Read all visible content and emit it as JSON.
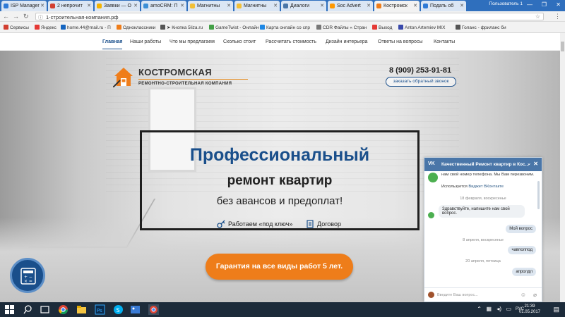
{
  "browser": {
    "tabs": [
      {
        "label": "ISP Manager",
        "color": "#2f7ad6"
      },
      {
        "label": "2 непрочит",
        "color": "#d23f31"
      },
      {
        "label": "Заявки — О",
        "color": "#f4b400"
      },
      {
        "label": "amoCRM: П",
        "color": "#3d8fd6"
      },
      {
        "label": "Магнитны",
        "color": "#f2c037"
      },
      {
        "label": "Магнитны",
        "color": "#f2c037"
      },
      {
        "label": "Диалоги",
        "color": "#4a76a8"
      },
      {
        "label": "Soc Advert",
        "color": "#ff9800"
      },
      {
        "label": "Костромск",
        "color": "#ef7d1a"
      },
      {
        "label": "Подать об",
        "color": "#2f7ad6"
      }
    ],
    "profile": "Пользователь 1",
    "url": "1-строительная-компания.рф",
    "bookmarks": [
      {
        "label": "Сервисы",
        "color": "#d23f31"
      },
      {
        "label": "Яндекс",
        "color": "#e53935"
      },
      {
        "label": "home.44@mail.ru - П",
        "color": "#1565c0"
      },
      {
        "label": "Одноклассники",
        "color": "#ef7d1a"
      },
      {
        "label": "➤ Кнопка 5liza.ru",
        "color": "#555555"
      },
      {
        "label": "GameTwist - Онлайн",
        "color": "#43a047"
      },
      {
        "label": "Карта онлайн со спр",
        "color": "#1e88e5"
      },
      {
        "label": "CDR Файлы « Стран",
        "color": "#777777"
      },
      {
        "label": "Выход",
        "color": "#e53935"
      },
      {
        "label": "Anton Artemiev MIX",
        "color": "#3949ab"
      },
      {
        "label": "Голанс - фриланс би",
        "color": "#555555"
      }
    ]
  },
  "site": {
    "menu": [
      {
        "label": "Главная",
        "active": true
      },
      {
        "label": "Наши работы"
      },
      {
        "label": "Что мы предлагаем"
      },
      {
        "label": "Сколько стоит"
      },
      {
        "label": "Рассчитать стоимость"
      },
      {
        "label": "Дизайн интерьера"
      },
      {
        "label": "Ответы на вопросы"
      },
      {
        "label": "Контакты"
      }
    ],
    "logo_title": "КОСТРОМСКАЯ",
    "logo_subtitle": "РЕМОНТНО-СТРОИТЕЛЬНАЯ КОМПАНИЯ",
    "phone": "8 (909) 253-91-81",
    "callback_label": "заказать обратный звонок",
    "heading_1": "Профессиональный",
    "heading_2": "ремонт квартир",
    "heading_3": "без авансов и предоплат!",
    "feature_1": "Работаем «под ключ»",
    "feature_2": "Договор",
    "cta_label": "Гарантия на все виды работ 5 лет.",
    "accent": "#1a4f8b",
    "cta_color": "#ee7d1a"
  },
  "vk_widget": {
    "title": "Качественный Ремонт квартир в Кос...",
    "intro": "нам свой номер телефона. Мы Вам перезвоним.",
    "powered_by": "Используется",
    "powered_link": "Виджет ВКонтакте",
    "messages": [
      {
        "type": "date",
        "text": "18 февраля, воскресенье"
      },
      {
        "type": "in",
        "text": "Здравствуйте, напишите нам свой вопрос."
      },
      {
        "type": "out",
        "text": "Мой вопрос"
      },
      {
        "type": "date",
        "text": "8 апреля, воскресенье"
      },
      {
        "type": "out",
        "text": "чавполпод"
      },
      {
        "type": "date",
        "text": "20 апреля, пятница"
      },
      {
        "type": "out",
        "text": "апролдл"
      }
    ],
    "input_placeholder": "Введите Ваш вопрос..."
  },
  "taskbar": {
    "language": "РУС",
    "time": "21:39",
    "date": "01.05.2017"
  }
}
